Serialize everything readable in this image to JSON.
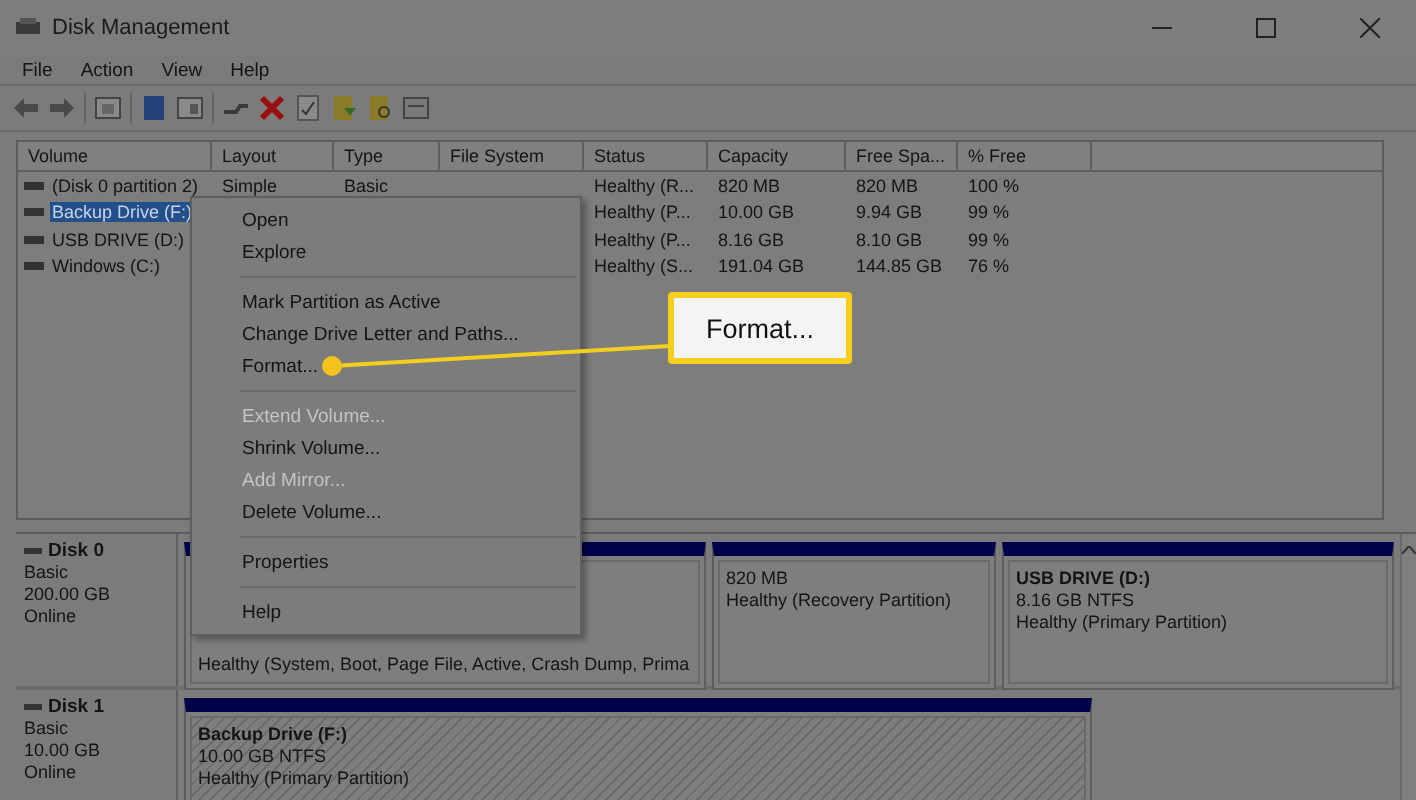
{
  "window": {
    "title": "Disk Management"
  },
  "menu_bar": [
    "File",
    "Action",
    "View",
    "Help"
  ],
  "table": {
    "columns": [
      "Volume",
      "Layout",
      "Type",
      "File System",
      "Status",
      "Capacity",
      "Free Spa...",
      "% Free"
    ],
    "rows": [
      {
        "selected": false,
        "cells": [
          "(Disk 0 partition 2)",
          "Simple",
          "Basic",
          "",
          "Healthy (R...",
          "820 MB",
          "820 MB",
          "100 %"
        ]
      },
      {
        "selected": true,
        "cells": [
          "Backup Drive (F:)",
          "",
          "",
          "",
          "Healthy (P...",
          "10.00 GB",
          "9.94 GB",
          "99 %"
        ]
      },
      {
        "selected": false,
        "cells": [
          "USB DRIVE (D:)",
          "",
          "",
          "",
          "Healthy (P...",
          "8.16 GB",
          "8.10 GB",
          "99 %"
        ]
      },
      {
        "selected": false,
        "cells": [
          "Windows (C:)",
          "",
          "",
          "",
          "Healthy (S...",
          "191.04 GB",
          "144.85 GB",
          "76 %"
        ]
      }
    ]
  },
  "context_menu": {
    "items": [
      {
        "kind": "item",
        "label": "Open",
        "disabled": false
      },
      {
        "kind": "item",
        "label": "Explore",
        "disabled": false
      },
      {
        "kind": "separator"
      },
      {
        "kind": "item",
        "label": "Mark Partition as Active",
        "disabled": false
      },
      {
        "kind": "item",
        "label": "Change Drive Letter and Paths...",
        "disabled": false
      },
      {
        "kind": "item",
        "label": "Format...",
        "disabled": false
      },
      {
        "kind": "separator"
      },
      {
        "kind": "item",
        "label": "Extend Volume...",
        "disabled": true
      },
      {
        "kind": "item",
        "label": "Shrink Volume...",
        "disabled": false
      },
      {
        "kind": "item",
        "label": "Add Mirror...",
        "disabled": true
      },
      {
        "kind": "item",
        "label": "Delete Volume...",
        "disabled": false
      },
      {
        "kind": "separator"
      },
      {
        "kind": "item",
        "label": "Properties",
        "disabled": false
      },
      {
        "kind": "separator"
      },
      {
        "kind": "item",
        "label": "Help",
        "disabled": false
      }
    ]
  },
  "callout": {
    "label": "Format..."
  },
  "disks": [
    {
      "name": "Disk 0",
      "type": "Basic",
      "size": "200.00 GB",
      "status": "Online",
      "partitions": [
        {
          "kind": "primary",
          "lines": [
            "Healthy (System, Boot, Page File, Active, Crash Dump, Prima"
          ]
        },
        {
          "kind": "primary",
          "lines": [
            "820 MB",
            "Healthy (Recovery Partition)"
          ]
        },
        {
          "kind": "primary",
          "title": "USB DRIVE  (D:)",
          "lines": [
            "8.16 GB NTFS",
            "Healthy (Primary Partition)"
          ]
        }
      ]
    },
    {
      "name": "Disk 1",
      "type": "Basic",
      "size": "10.00 GB",
      "status": "Online",
      "partitions": [
        {
          "kind": "selected",
          "title": "Backup Drive  (F:)",
          "lines": [
            "10.00 GB NTFS",
            "Healthy (Primary Partition)"
          ]
        }
      ]
    }
  ]
}
